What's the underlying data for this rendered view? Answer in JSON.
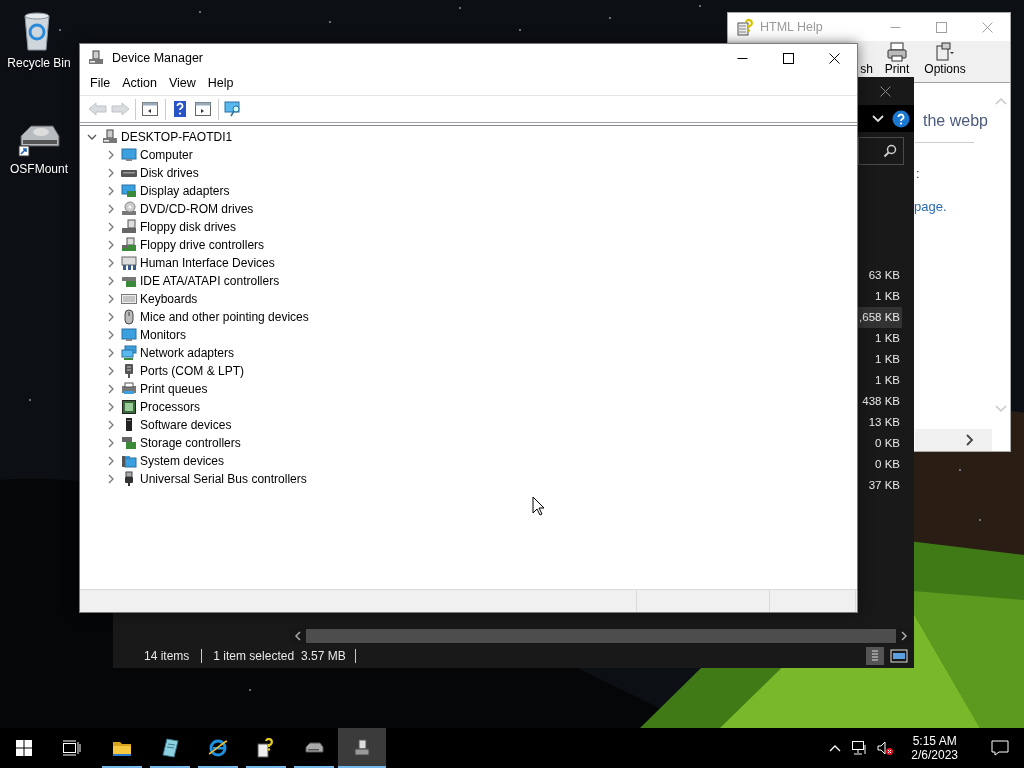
{
  "desktop_icons": [
    {
      "kind": "recycle-bin",
      "label": "Recycle Bin"
    },
    {
      "kind": "drive-shortcut",
      "label": "OSFMount"
    }
  ],
  "help_window": {
    "title": "HTML Help",
    "active": false,
    "toolbar": [
      {
        "kind": "refresh",
        "label": "sh"
      },
      {
        "kind": "print",
        "label": "Print"
      },
      {
        "kind": "options",
        "label": "Options"
      }
    ],
    "heading": "the webp",
    "colon": ":",
    "link": "page."
  },
  "explorer_window": {
    "sizes": [
      {
        "text": "63 KB",
        "selected": false
      },
      {
        "text": "1 KB",
        "selected": false
      },
      {
        "text": ",658 KB",
        "selected": true
      },
      {
        "text": "1 KB",
        "selected": false
      },
      {
        "text": "1 KB",
        "selected": false
      },
      {
        "text": "1 KB",
        "selected": false
      },
      {
        "text": "438 KB",
        "selected": false
      },
      {
        "text": "13 KB",
        "selected": false
      },
      {
        "text": "0 KB",
        "selected": false
      },
      {
        "text": "0 KB",
        "selected": false
      },
      {
        "text": "37 KB",
        "selected": false
      }
    ],
    "status": [
      "14 items",
      "1 item selected",
      "3.57 MB"
    ]
  },
  "device_manager": {
    "title": "Device Manager",
    "active": true,
    "menu": [
      "File",
      "Action",
      "View",
      "Help"
    ],
    "toolbar": [
      {
        "buttons": [
          {
            "kind": "back",
            "disabled": true
          },
          {
            "kind": "forward",
            "disabled": true
          }
        ]
      },
      {
        "buttons": [
          {
            "kind": "tree-pane",
            "disabled": false
          }
        ]
      },
      {
        "buttons": [
          {
            "kind": "help",
            "disabled": false
          },
          {
            "kind": "action-pane",
            "disabled": false
          }
        ]
      },
      {
        "buttons": [
          {
            "kind": "scan",
            "disabled": false
          }
        ]
      }
    ],
    "root": {
      "label": "DESKTOP-FAOTDI1",
      "kind": "computer",
      "expanded": true,
      "children": [
        {
          "label": "Computer",
          "kind": "monitor",
          "expanded": false
        },
        {
          "label": "Disk drives",
          "kind": "disk",
          "expanded": false
        },
        {
          "label": "Display adapters",
          "kind": "display",
          "expanded": false
        },
        {
          "label": "DVD/CD-ROM drives",
          "kind": "dvd",
          "expanded": false
        },
        {
          "label": "Floppy disk drives",
          "kind": "floppy",
          "expanded": false
        },
        {
          "label": "Floppy drive controllers",
          "kind": "floppy-controller",
          "expanded": false
        },
        {
          "label": "Human Interface Devices",
          "kind": "hid",
          "expanded": false
        },
        {
          "label": "IDE ATA/ATAPI controllers",
          "kind": "ide",
          "expanded": false
        },
        {
          "label": "Keyboards",
          "kind": "keyboard",
          "expanded": false
        },
        {
          "label": "Mice and other pointing devices",
          "kind": "mouse",
          "expanded": false
        },
        {
          "label": "Monitors",
          "kind": "monitor",
          "expanded": false
        },
        {
          "label": "Network adapters",
          "kind": "network",
          "expanded": false
        },
        {
          "label": "Ports (COM & LPT)",
          "kind": "port",
          "expanded": false
        },
        {
          "label": "Print queues",
          "kind": "printer",
          "expanded": false
        },
        {
          "label": "Processors",
          "kind": "processor",
          "expanded": false
        },
        {
          "label": "Software devices",
          "kind": "software",
          "expanded": false
        },
        {
          "label": "Storage controllers",
          "kind": "storage",
          "expanded": false
        },
        {
          "label": "System devices",
          "kind": "system",
          "expanded": false
        },
        {
          "label": "Universal Serial Bus controllers",
          "kind": "usb",
          "expanded": false
        }
      ]
    }
  },
  "taskbar": {
    "apps": [
      {
        "kind": "folder",
        "selected": false
      },
      {
        "kind": "notebook",
        "selected": false
      },
      {
        "kind": "browser",
        "selected": false
      },
      {
        "kind": "help",
        "selected": false
      },
      {
        "kind": "drive",
        "selected": false
      },
      {
        "kind": "device-manager",
        "selected": true
      }
    ],
    "time": "5:15 AM",
    "date": "2/6/2023"
  }
}
